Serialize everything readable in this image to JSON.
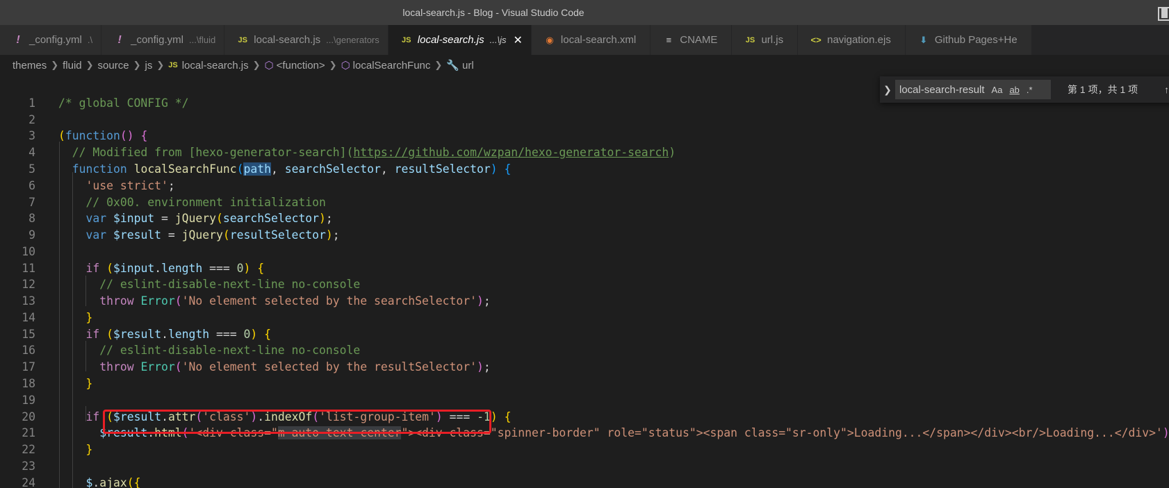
{
  "window": {
    "title": "local-search.js - Blog - Visual Studio Code"
  },
  "tabs": [
    {
      "icon": "!",
      "name": "_config.yml",
      "desc": ".\\",
      "kind": "yml"
    },
    {
      "icon": "!",
      "name": "_config.yml",
      "desc": "...\\fluid",
      "kind": "yml"
    },
    {
      "icon": "JS",
      "name": "local-search.js",
      "desc": "...\\generators",
      "kind": "js"
    },
    {
      "icon": "JS",
      "name": "local-search.js",
      "desc": "...\\js",
      "kind": "js",
      "active": true,
      "close": "✕"
    },
    {
      "icon": "◉",
      "name": "local-search.xml",
      "desc": "",
      "kind": "rss"
    },
    {
      "icon": "≡",
      "name": "CNAME",
      "desc": "",
      "kind": "lines"
    },
    {
      "icon": "JS",
      "name": "url.js",
      "desc": "",
      "kind": "js"
    },
    {
      "icon": "<>",
      "name": "navigation.ejs",
      "desc": "",
      "kind": "ejs"
    },
    {
      "icon": "⬇",
      "name": "Github Pages+He",
      "desc": "",
      "kind": "gh"
    }
  ],
  "breadcrumb": {
    "items": [
      "themes",
      "fluid",
      "source",
      "js",
      "local-search.js",
      "<function>",
      "localSearchFunc",
      "url"
    ],
    "js_icon": "JS"
  },
  "find": {
    "query": "local-search-result",
    "match_case": "Aa",
    "whole_word": "ab",
    "regex": ".*",
    "result": "第 1 项，共 1 项"
  },
  "editor": {
    "line_numbers": [
      "1",
      "2",
      "3",
      "4",
      "5",
      "6",
      "7",
      "8",
      "9",
      "10",
      "11",
      "12",
      "13",
      "14",
      "15",
      "16",
      "17",
      "18",
      "19",
      "20",
      "21",
      "22",
      "23",
      "24"
    ],
    "colors": {
      "keyword": "#569cd6",
      "control": "#c586c0",
      "comment": "#6a9955",
      "string": "#ce9178",
      "function": "#dcdcaa",
      "variable": "#9cdcfe",
      "highlight_box": "#e81e25"
    },
    "code": {
      "l1": "/* global CONFIG */",
      "l3_kw": "function",
      "l4_comment": "// Modified from [hexo-generator-search](",
      "l4_link": "https://github.com/wzpan/hexo-generator-search",
      "l4_end": ")",
      "l5_kw": "function",
      "l5_fn": "localSearchFunc",
      "l5_p1": "path",
      "l5_p2": "searchSelector",
      "l5_p3": "resultSelector",
      "l6_str": "'use strict'",
      "l7_comment": "// 0x00. environment initialization",
      "l8_var": "var",
      "l8_name": "$input",
      "l8_fn": "jQuery",
      "l8_arg": "searchSelector",
      "l9_var": "var",
      "l9_name": "$result",
      "l9_fn": "jQuery",
      "l9_arg": "resultSelector",
      "l11_if": "if",
      "l11_obj": "$input",
      "l11_prop": "length",
      "l11_num": "0",
      "l12_comment": "// eslint-disable-next-line no-console",
      "l13_throw": "throw",
      "l13_cls": "Error",
      "l13_str": "'No element selected by the searchSelector'",
      "l15_if": "if",
      "l15_obj": "$result",
      "l15_prop": "length",
      "l15_num": "0",
      "l16_comment": "// eslint-disable-next-line no-console",
      "l17_throw": "throw",
      "l17_cls": "Error",
      "l17_str": "'No element selected by the resultSelector'",
      "l20_if": "if",
      "l20_obj": "$result",
      "l20_fn1": "attr",
      "l20_str1": "'class'",
      "l20_fn2": "indexOf",
      "l20_str2": "'list-group-item'",
      "l20_num": "-1",
      "l21_obj": "$result",
      "l21_fn": "html",
      "l21_str_a": "'<div class=\"",
      "l21_str_sel": "m-auto text-center",
      "l21_str_b": "\"><div class=\"spinner-border\" role=\"status\"><span class=\"sr-only\">Loading...</span></div><br/>Loading...</div>'",
      "l24_obj": "$",
      "l24_fn": "ajax"
    }
  }
}
